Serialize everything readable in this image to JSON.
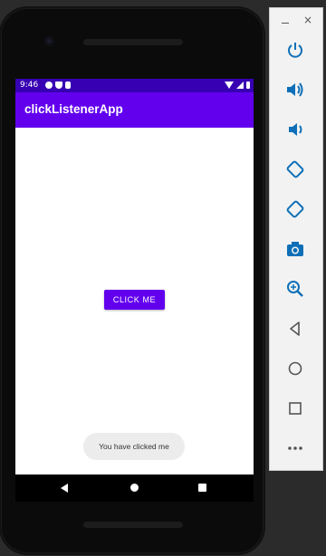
{
  "status_bar": {
    "time": "9:46"
  },
  "app": {
    "title": "clickListenerApp",
    "button_label": "CLICK ME",
    "toast_message": "You have clicked me"
  },
  "toolbar": {
    "window_controls": [
      "minimize-icon",
      "close-icon"
    ],
    "close_glyph": "×",
    "buttons": [
      {
        "name": "power-button",
        "icon": "power-icon"
      },
      {
        "name": "volume-up-button",
        "icon": "volume-up-icon"
      },
      {
        "name": "volume-down-button",
        "icon": "volume-down-icon"
      },
      {
        "name": "rotate-left-button",
        "icon": "rotate-left-icon"
      },
      {
        "name": "rotate-right-button",
        "icon": "rotate-right-icon"
      },
      {
        "name": "screenshot-button",
        "icon": "camera-icon"
      },
      {
        "name": "zoom-button",
        "icon": "zoom-icon"
      },
      {
        "name": "back-button",
        "icon": "back-icon"
      },
      {
        "name": "home-button",
        "icon": "home-icon"
      },
      {
        "name": "overview-button",
        "icon": "overview-icon"
      },
      {
        "name": "more-button",
        "icon": "more-icon"
      }
    ]
  },
  "colors": {
    "status_bar": "#3700b3",
    "app_bar": "#6200ee",
    "button": "#6200ee",
    "toolbar_icon": "#0e6fb8"
  }
}
